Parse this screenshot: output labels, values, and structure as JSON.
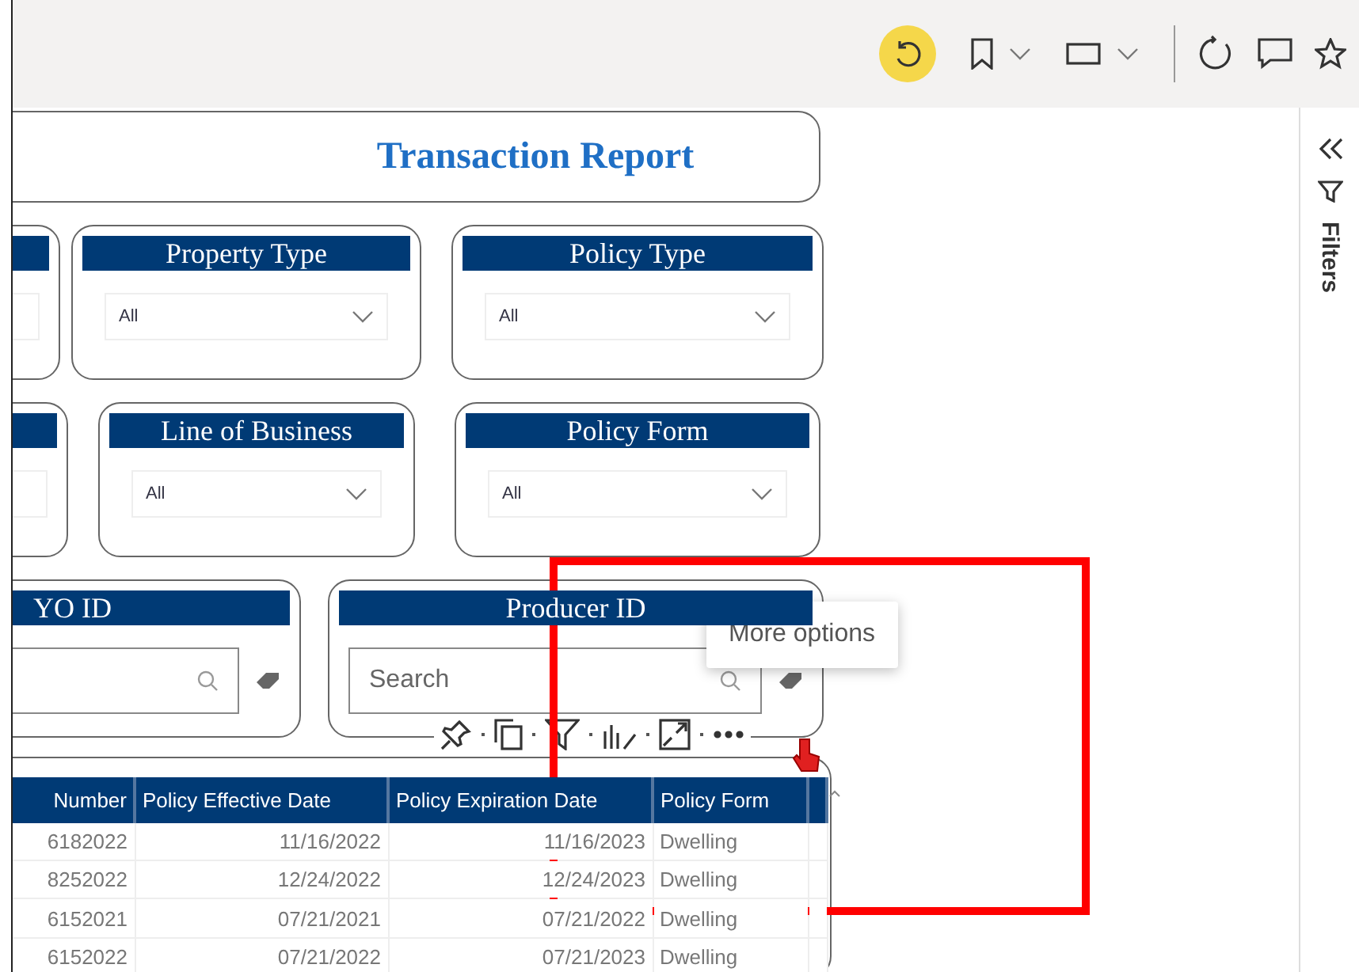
{
  "report": {
    "title": "Transaction Report",
    "slicer_rows": [
      [
        {
          "kind": "cut"
        },
        {
          "kind": "dropdown",
          "title": "Property Type",
          "value": "All"
        },
        {
          "kind": "dropdown",
          "title": "Policy Type",
          "value": "All"
        }
      ],
      [
        {
          "kind": "cut"
        },
        {
          "kind": "dropdown",
          "title": "Line of Business",
          "value": "All"
        },
        {
          "kind": "dropdown",
          "title": "Policy Form",
          "value": "All"
        }
      ],
      [
        {
          "kind": "search",
          "title": "YO ID"
        },
        {
          "kind": "search",
          "title": "Producer ID",
          "placeholder": "Search"
        }
      ]
    ],
    "visual_header": {
      "tooltip": "More options"
    },
    "table": {
      "columns": [
        "Number",
        "Policy Effective Date",
        "Policy Expiration Date",
        "Policy Form"
      ],
      "rows": [
        [
          "6182022",
          "11/16/2022",
          "11/16/2023",
          "Dwelling"
        ],
        [
          "8252022",
          "12/24/2022",
          "12/24/2023",
          "Dwelling"
        ],
        [
          "6152021",
          "07/21/2021",
          "07/21/2022",
          "Dwelling"
        ],
        [
          "6152022",
          "07/21/2022",
          "07/21/2023",
          "Dwelling"
        ]
      ]
    }
  },
  "filters_pane": {
    "label": "Filters"
  }
}
